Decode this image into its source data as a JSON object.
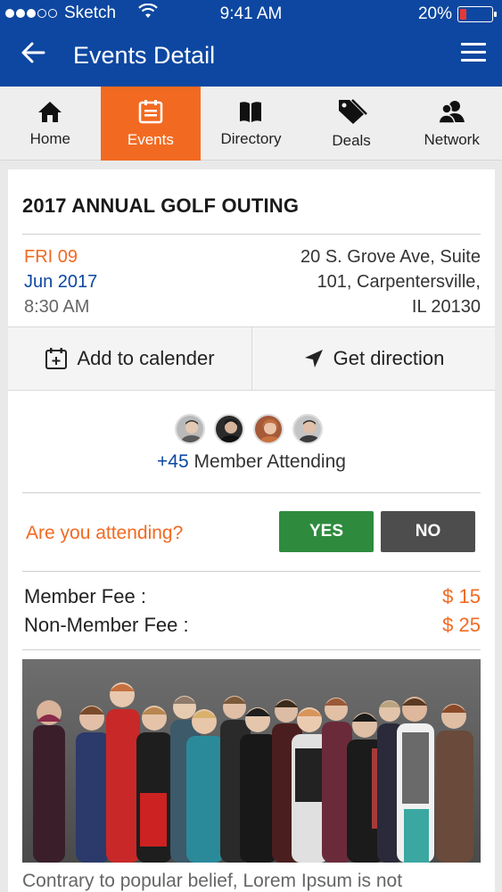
{
  "status_bar": {
    "carrier": "Sketch",
    "time": "9:41 AM",
    "battery": "20%",
    "battery_level": 0.2
  },
  "header": {
    "title": "Events Detail"
  },
  "tabs": [
    {
      "label": "Home",
      "icon": "home-icon"
    },
    {
      "label": "Events",
      "icon": "calendar-icon",
      "active": true
    },
    {
      "label": "Directory",
      "icon": "book-icon"
    },
    {
      "label": "Deals",
      "icon": "tag-icon"
    },
    {
      "label": "Network",
      "icon": "people-icon"
    }
  ],
  "event": {
    "title": "2017 ANNUAL GOLF OUTING",
    "day": "FRI 09",
    "month_year": "Jun 2017",
    "time": "8:30 AM",
    "address_lines": [
      "20 S. Grove Ave, Suite",
      "101, Carpentersville,",
      "IL 20130"
    ]
  },
  "actions": {
    "add_calendar": "Add to calender",
    "get_direction": "Get direction"
  },
  "attendance": {
    "count": "+45",
    "label": "Member Attending"
  },
  "rsvp": {
    "question": "Are you attending?",
    "yes": "YES",
    "no": "NO"
  },
  "fees": {
    "member_label": "Member Fee :",
    "member_value": "$ 15",
    "nonmember_label": "Non-Member Fee :",
    "nonmember_value": "$ 25"
  },
  "description": "Contrary to popular belief, Lorem Ipsum is not",
  "colors": {
    "header": "#0d47a1",
    "accent": "#f26a21",
    "yes": "#2e8b3e",
    "no": "#4d4d4d"
  }
}
